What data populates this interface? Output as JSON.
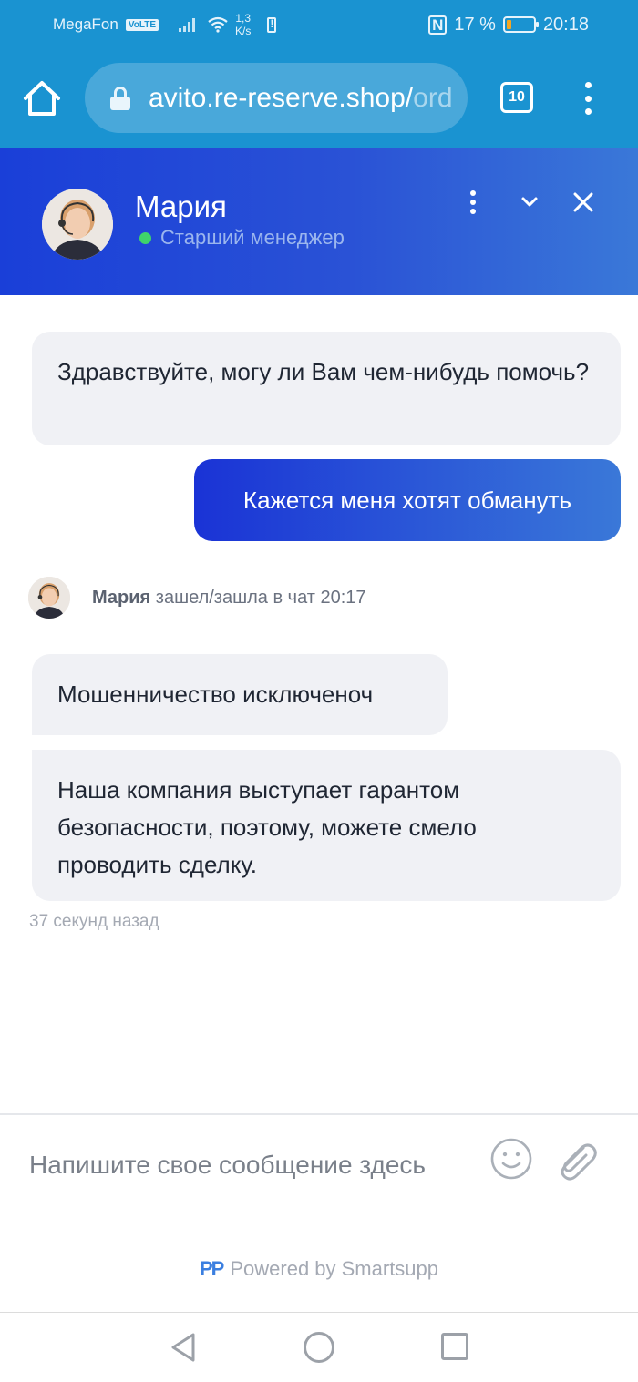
{
  "status_bar": {
    "carrier": "MegaFon",
    "volte": "VoLTE",
    "speed_value": "1,3",
    "speed_unit": "K/s",
    "nfc": "N",
    "battery_percent": "17 %",
    "battery_level": 0.17,
    "time": "20:18"
  },
  "browser": {
    "url_main": "avito.re-reserve.shop/",
    "url_faded": "ord",
    "tab_count": "10",
    "accent": "#1a93d1"
  },
  "chat": {
    "header": {
      "agent_name": "Мария",
      "agent_role": "Старший менеджер",
      "status_color": "#3fd46b"
    },
    "messages": [
      {
        "from": "agent",
        "text": "Здравствуйте, могу ли Вам чем-нибудь помочь?"
      },
      {
        "from": "user",
        "text": "Кажется меня хотят обмануть"
      },
      {
        "from": "agent",
        "text": "Мошенничество исключеноч"
      },
      {
        "from": "agent",
        "text": "Наша компания выступает гарантом безопасности, поэтому, можете смело проводить сделку."
      }
    ],
    "join_event": {
      "name": "Мария",
      "text": " зашел/зашла в чат 20:17"
    },
    "time_ago": "37 секунд назад",
    "composer": {
      "placeholder": "Напишите свое сообщение здесь"
    },
    "powered_by": {
      "logo": "PP",
      "text": "Powered by Smartsupp"
    }
  }
}
